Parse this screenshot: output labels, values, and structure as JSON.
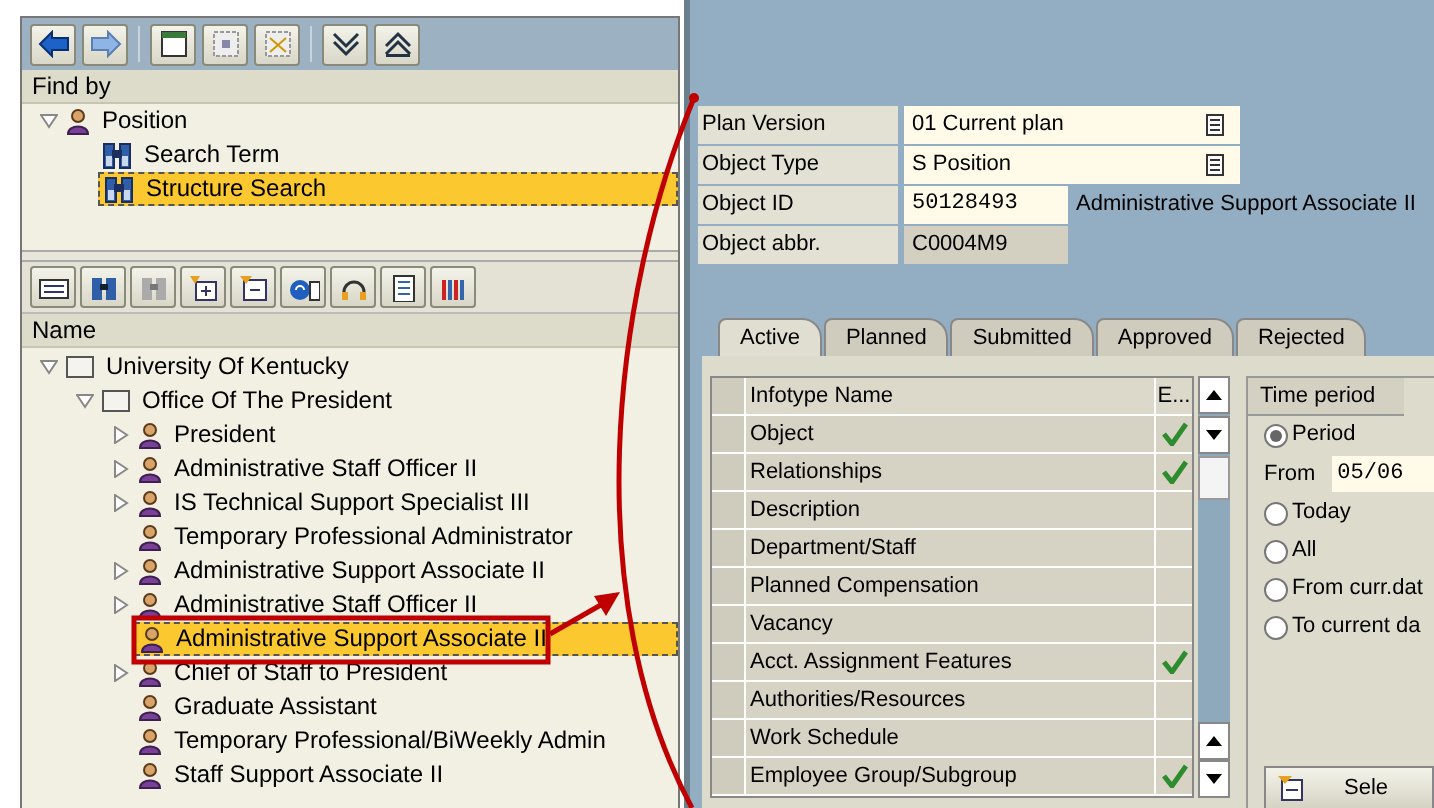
{
  "find_by": {
    "header": "Find by",
    "tree": [
      {
        "label": "Position",
        "kind": "person",
        "has_children": true,
        "expanded": true,
        "selected": false,
        "children": [
          {
            "label": "Search Term",
            "kind": "search",
            "has_children": false,
            "selected": false
          },
          {
            "label": "Structure Search",
            "kind": "search",
            "has_children": false,
            "selected": true
          }
        ]
      }
    ]
  },
  "hierarchy": {
    "header": "Name",
    "tree": [
      {
        "label": "University Of Kentucky",
        "kind": "org",
        "has_children": true,
        "expanded": true,
        "selected": false,
        "children": [
          {
            "label": "Office Of The President",
            "kind": "org",
            "has_children": true,
            "expanded": true,
            "selected": false,
            "children": [
              {
                "label": "President",
                "kind": "person",
                "has_children": true,
                "expanded": false,
                "selected": false
              },
              {
                "label": "Administrative Staff Officer II",
                "kind": "person",
                "has_children": true,
                "expanded": false,
                "selected": false
              },
              {
                "label": "IS Technical Support Specialist III",
                "kind": "person",
                "has_children": true,
                "expanded": false,
                "selected": false
              },
              {
                "label": "Temporary Professional Administrator",
                "kind": "person",
                "has_children": false,
                "selected": false
              },
              {
                "label": "Administrative Support Associate II",
                "kind": "person",
                "has_children": true,
                "expanded": false,
                "selected": false
              },
              {
                "label": "Administrative Staff Officer II",
                "kind": "person",
                "has_children": true,
                "expanded": false,
                "selected": false
              },
              {
                "label": "Administrative Support Associate II",
                "kind": "person",
                "has_children": false,
                "selected": true
              },
              {
                "label": "Chief of Staff to President",
                "kind": "person",
                "has_children": true,
                "expanded": false,
                "selected": false
              },
              {
                "label": "Graduate Assistant",
                "kind": "person",
                "has_children": false,
                "selected": false
              },
              {
                "label": "Temporary Professional/BiWeekly Admin",
                "kind": "person",
                "has_children": false,
                "selected": false
              },
              {
                "label": "Staff Support Associate II",
                "kind": "person",
                "has_children": false,
                "selected": false
              }
            ]
          }
        ]
      }
    ]
  },
  "header_fields": [
    {
      "label": "Plan Version",
      "value": "01 Current plan",
      "kind": "dropdown"
    },
    {
      "label": "Object Type",
      "value": "S Position",
      "kind": "dropdown"
    },
    {
      "label": "Object ID",
      "value": "50128493",
      "kind": "input",
      "description": "Administrative Support Associate II"
    },
    {
      "label": "Object abbr.",
      "value": "C0004M9",
      "kind": "readonly"
    }
  ],
  "tabs": [
    {
      "label": "Active",
      "selected": true
    },
    {
      "label": "Planned",
      "selected": false
    },
    {
      "label": "Submitted",
      "selected": false
    },
    {
      "label": "Approved",
      "selected": false
    },
    {
      "label": "Rejected",
      "selected": false
    }
  ],
  "infotype_table": {
    "columns": [
      "Infotype Name",
      "E..."
    ],
    "rows": [
      {
        "name": "Object",
        "exists": true
      },
      {
        "name": "Relationships",
        "exists": true
      },
      {
        "name": "Description",
        "exists": false
      },
      {
        "name": "Department/Staff",
        "exists": false
      },
      {
        "name": "Planned Compensation",
        "exists": false
      },
      {
        "name": "Vacancy",
        "exists": false
      },
      {
        "name": "Acct. Assignment Features",
        "exists": true
      },
      {
        "name": "Authorities/Resources",
        "exists": false
      },
      {
        "name": "Work Schedule",
        "exists": false
      },
      {
        "name": "Employee Group/Subgroup",
        "exists": true
      }
    ]
  },
  "time_period": {
    "title": "Time period",
    "options": [
      {
        "label": "Period",
        "selected": true
      },
      {
        "label": "Today",
        "selected": false
      },
      {
        "label": "All",
        "selected": false
      },
      {
        "label": "From curr.dat",
        "selected": false
      },
      {
        "label": "To current da",
        "selected": false
      }
    ],
    "from_label": "From",
    "from_value": "05/06",
    "button": "Sele"
  }
}
